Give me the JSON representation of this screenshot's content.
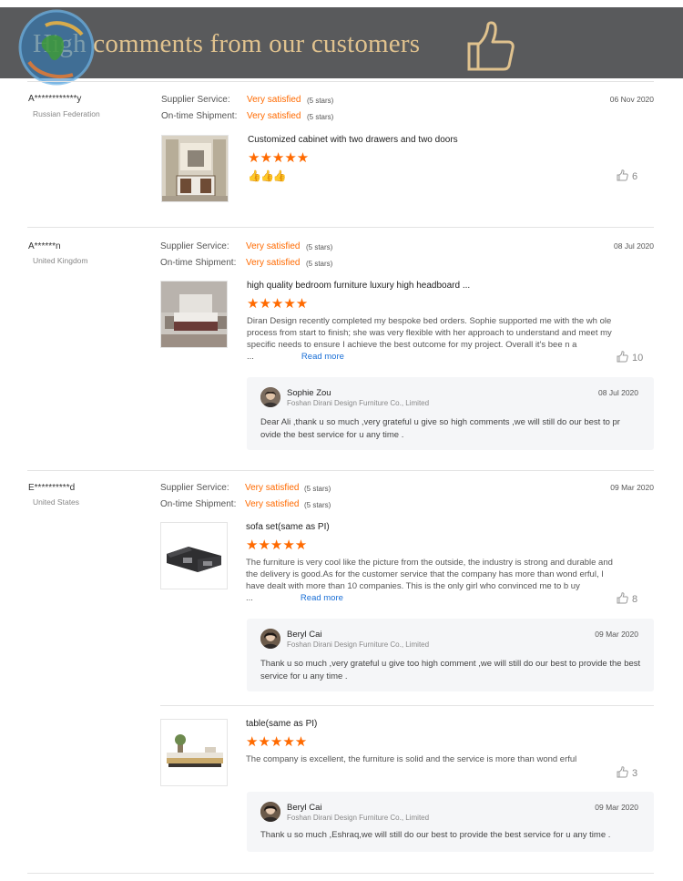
{
  "banner": {
    "title": "High comments from our customers",
    "logo_icon": "globe-logo-icon",
    "thumb_icon": "thumbs-up-icon",
    "colors": {
      "background": "#595a5c",
      "title": "#e0c28e"
    }
  },
  "accent_color": "#ff6a00",
  "link_color": "#1a6fd6",
  "labels": {
    "supplier_service": "Supplier Service:",
    "ontime_shipment": "On-time Shipment:",
    "read_more": "Read more"
  },
  "reviews": [
    {
      "user": "A************y",
      "country": "Russian Federation",
      "date": "06 Nov 2020",
      "supplier_service": {
        "value": "Very satisfied",
        "stars": "(5 stars)"
      },
      "ontime_shipment": {
        "value": "Very satisfied",
        "stars": "(5 stars)"
      },
      "items": [
        {
          "product": "Customized cabinet with two drawers and two doors",
          "rating_stars": "★★★★★",
          "rating": 5,
          "text": "👍👍👍",
          "likes": "6"
        }
      ]
    },
    {
      "user": "A******n",
      "country": "United Kingdom",
      "date": "08 Jul 2020",
      "supplier_service": {
        "value": "Very satisfied",
        "stars": "(5 stars)"
      },
      "ontime_shipment": {
        "value": "Very satisfied",
        "stars": "(5 stars)"
      },
      "items": [
        {
          "product": "high quality bedroom furniture luxury high headboard ...",
          "rating_stars": "★★★★★",
          "rating": 5,
          "text": "Diran Design recently completed my bespoke bed orders. Sophie supported me with the wh ole process from start to finish; she was very flexible with her approach to understand and meet my specific needs to ensure I achieve the best outcome for my project. Overall it's bee n a ...",
          "likes": "10",
          "reply": {
            "name": "Sophie Zou",
            "company": "Foshan Dirani Design Furniture Co., Limited",
            "date": "08 Jul 2020",
            "text": "Dear Ali ,thank u so much ,very grateful u give so high comments ,we will still do our best to pr ovide the best service for u any time ."
          }
        }
      ]
    },
    {
      "user": "E**********d",
      "country": "United States",
      "date": "09 Mar 2020",
      "supplier_service": {
        "value": "Very satisfied",
        "stars": "(5 stars)"
      },
      "ontime_shipment": {
        "value": "Very satisfied",
        "stars": "(5 stars)"
      },
      "items": [
        {
          "product": "sofa set(same as PI)",
          "rating_stars": "★★★★★",
          "rating": 5,
          "text": "The furniture is very cool like the picture from the outside, the industry is strong and durable and the delivery is good.As for the customer service that the company has more than wond erful, I have dealt with more than 10 companies. This is the only girl who convinced me to b uy ...",
          "likes": "8",
          "reply": {
            "name": "Beryl Cai",
            "company": "Foshan Dirani Design Furniture Co., Limited",
            "date": "09 Mar 2020",
            "text": "Thank u so much ,very grateful u give too high comment ,we will still do our best to provide the best service for u any time ."
          }
        },
        {
          "product": "table(same as PI)",
          "rating_stars": "★★★★★",
          "rating": 5,
          "text": "The company is excellent, the furniture is solid and the service is more than wond erful",
          "likes": "3",
          "reply": {
            "name": "Beryl Cai",
            "company": "Foshan Dirani Design Furniture Co., Limited",
            "date": "09 Mar 2020",
            "text": "Thank u so much ,Eshraq,we will still do our best to provide the best service for u any time ."
          }
        }
      ]
    }
  ]
}
